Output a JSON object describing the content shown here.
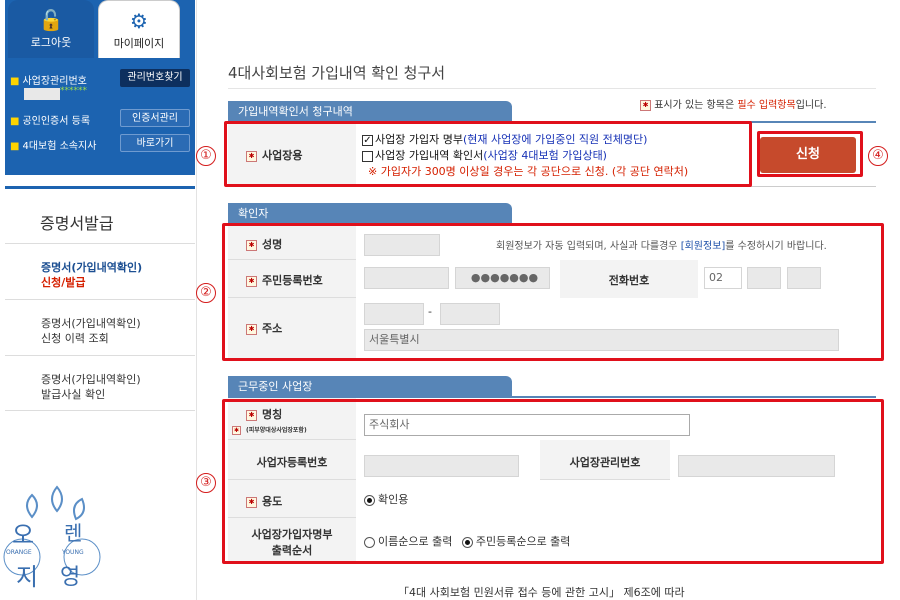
{
  "sidebar": {
    "logout_label": "로그아웃",
    "mypage_label": "마이페이지",
    "mgmt_no_label": "사업장관리번호",
    "mgmt_no_value": "******",
    "find_mgmt_no_label": "관리번호찾기",
    "cert_label": "공인인증서 등록",
    "cert_mgmt_label": "인증서관리",
    "branch_label": "4대보험 소속지사",
    "goto_label": "바로가기",
    "menu_title": "증명서발급",
    "menu": [
      {
        "line1": "증명서(가입내역확인)",
        "line2": "신청/발급"
      },
      {
        "line1": "증명서(가입내역확인)",
        "line2": "신청 이력 조회"
      },
      {
        "line1": "증명서(가입내역확인)",
        "line2": "발급사실 확인"
      }
    ],
    "logo_text": [
      "오",
      "렌",
      "지",
      "영"
    ],
    "logo_sub": [
      "ORANGE",
      "YOUNG"
    ]
  },
  "page_title": "4대사회보험 가입내역 확인 청구서",
  "required_note": {
    "prefix": "표시가 있는 항목은 ",
    "emphasis": "필수 입력항목",
    "suffix": "입니다."
  },
  "section1": {
    "tab": "가입내역확인서 청구내역",
    "label": "사업장용",
    "option1_title": "사업장 가입자 명부",
    "option1_note": "(현재 사업장에 가입중인 직원 전체명단)",
    "option2_title": "사업장 가입내역 확인서",
    "option2_note": "(사업장 4대보험 가입상태)",
    "warning": "※ 가입자가 300명 이상일 경우는 각 공단으로 신청. (각 공단 연락처)",
    "submit_label": "신청"
  },
  "section2": {
    "tab": "확인자",
    "name_label": "성명",
    "notice_prefix": "회원정보가 자동 입력되며, 사실과 다를경우 ",
    "notice_link": "[회원정보]",
    "notice_suffix": "를 수정하시기 바랍니다.",
    "rrn_label": "주민등록번호",
    "rrn_masked": "●●●●●●●",
    "phone_label": "전화번호",
    "phone_prefix": "02",
    "address_label": "주소",
    "zip_dash": "-",
    "address_value": "서울특별시"
  },
  "section3": {
    "tab": "근무중인 사업장",
    "name_label": "명칭",
    "name_sub": "(피부양대상사업장포함)",
    "name_value": "주식회사",
    "bizno_label": "사업자등록번호",
    "mgmt_label": "사업장관리번호",
    "purpose_label": "용도",
    "purpose_value": "확인용",
    "order_label_1": "사업장가입자명부",
    "order_label_2": "출력순서",
    "order_opt1": "이름순으로 출력",
    "order_opt2": "주민등록순으로 출력"
  },
  "footer_note": "「4대 사회보험 민원서류 접수 등에 관한 고시」 제6조에 따라",
  "annotations": [
    "①",
    "②",
    "③",
    "④"
  ],
  "colors": {
    "sidebar_blue": "#1c63b0",
    "section_tab": "#5785b7",
    "submit": "#c64a2c",
    "highlight": "#e0101b"
  }
}
